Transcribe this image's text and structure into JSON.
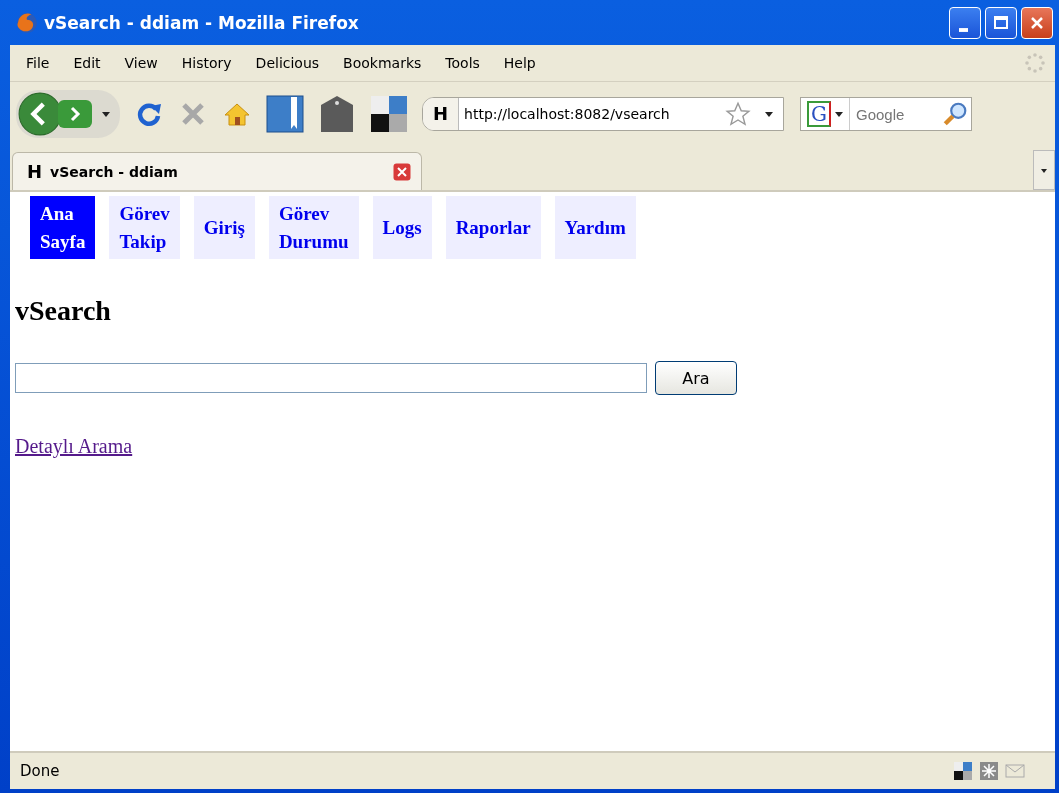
{
  "window": {
    "title": "vSearch - ddiam - Mozilla Firefox"
  },
  "menu": [
    "File",
    "Edit",
    "View",
    "History",
    "Delicious",
    "Bookmarks",
    "Tools",
    "Help"
  ],
  "toolbar": {
    "site_letter": "H",
    "url": "http://localhost:8082/vsearch",
    "search_engine_letter": "G",
    "search_placeholder": "Google"
  },
  "tabs": [
    {
      "letter": "H",
      "label": "vSearch - ddiam",
      "selected": true
    }
  ],
  "page": {
    "nav": [
      {
        "label": "Ana Sayfa",
        "selected": true
      },
      {
        "label": "Görev Takip",
        "selected": false
      },
      {
        "label": "Giriş",
        "selected": false
      },
      {
        "label": "Görev Durumu",
        "selected": false
      },
      {
        "label": "Logs",
        "selected": false
      },
      {
        "label": "Raporlar",
        "selected": false
      },
      {
        "label": "Yardım",
        "selected": false
      }
    ],
    "heading": "vSearch",
    "search_button": "Ara",
    "link": "Detaylı Arama"
  },
  "status_bar": {
    "text": "Done"
  }
}
